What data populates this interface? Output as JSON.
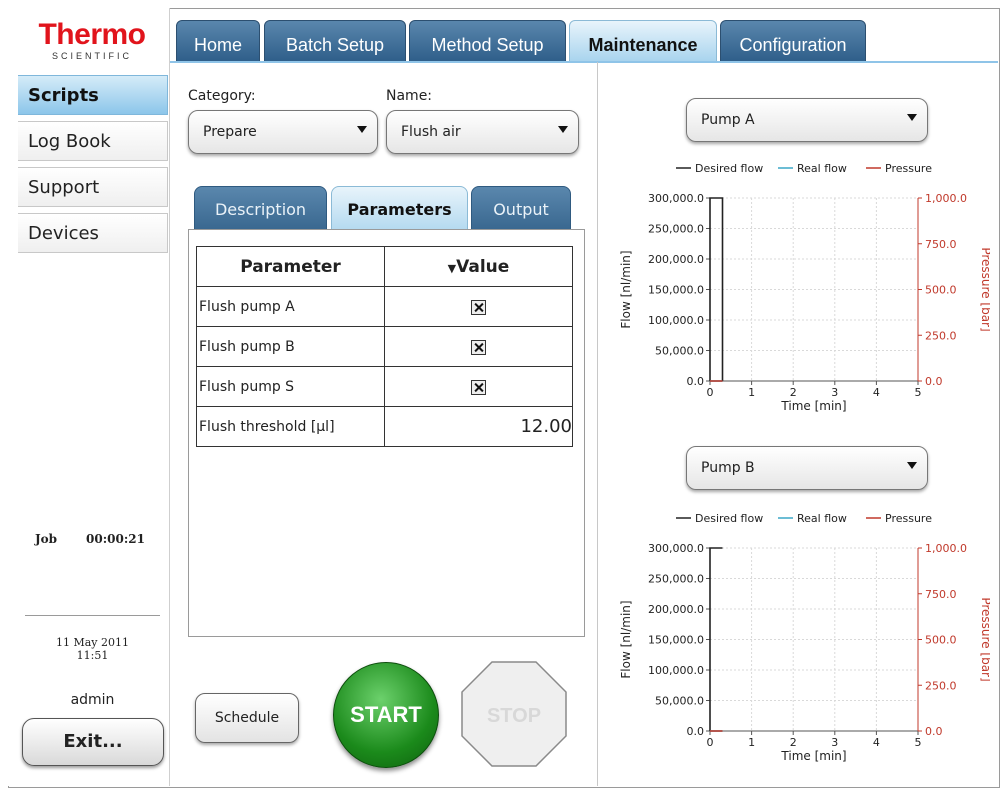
{
  "brand": {
    "name": "Thermo",
    "sub": "SCIENTIFIC"
  },
  "sidebar": {
    "items": [
      {
        "label": "Scripts",
        "active": true
      },
      {
        "label": "Log Book",
        "active": false
      },
      {
        "label": "Support",
        "active": false
      },
      {
        "label": "Devices",
        "active": false
      }
    ]
  },
  "status": {
    "job_label": "Job",
    "job_time": "00:00:21",
    "date": "11 May 2011",
    "time": "11:51",
    "user": "admin",
    "exit_label": "Exit..."
  },
  "tabs": [
    {
      "label": "Home",
      "active": false
    },
    {
      "label": "Batch Setup",
      "active": false
    },
    {
      "label": "Method Setup",
      "active": false
    },
    {
      "label": "Maintenance",
      "active": true
    },
    {
      "label": "Configuration",
      "active": false
    }
  ],
  "script": {
    "category_label": "Category:",
    "category_value": "Prepare",
    "name_label": "Name:",
    "name_value": "Flush air",
    "subtabs": [
      {
        "label": "Description",
        "active": false
      },
      {
        "label": "Parameters",
        "active": true
      },
      {
        "label": "Output",
        "active": false
      }
    ],
    "table": {
      "col_param": "Parameter",
      "col_value": "Value",
      "rows": [
        {
          "name": "Flush pump A",
          "type": "checkbox",
          "checked": true
        },
        {
          "name": "Flush pump B",
          "type": "checkbox",
          "checked": true
        },
        {
          "name": "Flush pump S",
          "type": "checkbox",
          "checked": true
        },
        {
          "name": "Flush threshold [µl]",
          "type": "number",
          "value": "12.00"
        }
      ]
    },
    "schedule_label": "Schedule",
    "start_label": "START",
    "stop_label": "STOP"
  },
  "colors": {
    "desired": "#222222",
    "real": "#3aa7c7",
    "pressure": "#c0392b",
    "accent": "#2f5f8a"
  },
  "chart_data": [
    {
      "type": "line",
      "selector": "Pump A",
      "legend": [
        "Desired flow",
        "Real flow",
        "Pressure"
      ],
      "xlabel": "Time [min]",
      "ylabel": "Flow [nl/min]",
      "y2label": "Pressure [bar]",
      "xlim": [
        0,
        5
      ],
      "ylim": [
        0,
        300000
      ],
      "y2lim": [
        0,
        1000
      ],
      "xticks": [
        "0",
        "1",
        "2",
        "3",
        "4",
        "5"
      ],
      "yticks": [
        "0.0",
        "50,000.0",
        "100,000.0",
        "150,000.0",
        "200,000.0",
        "250,000.0",
        "300,000.0"
      ],
      "y2ticks": [
        "0.0",
        "250.0",
        "500.0",
        "750.0",
        "1,000.0"
      ],
      "series": [
        {
          "name": "Desired flow",
          "x": [
            0,
            0,
            0.3,
            0.3
          ],
          "y": [
            0,
            300000,
            300000,
            0
          ]
        },
        {
          "name": "Real flow",
          "x": [
            0,
            0.3
          ],
          "y": [
            0,
            0
          ]
        },
        {
          "name": "Pressure",
          "x": [
            0,
            0.3
          ],
          "y2": [
            0,
            0
          ]
        }
      ]
    },
    {
      "type": "line",
      "selector": "Pump B",
      "legend": [
        "Desired flow",
        "Real flow",
        "Pressure"
      ],
      "xlabel": "Time [min]",
      "ylabel": "Flow [nl/min]",
      "y2label": "Pressure [bar]",
      "xlim": [
        0,
        5
      ],
      "ylim": [
        0,
        300000
      ],
      "y2lim": [
        0,
        1000
      ],
      "xticks": [
        "0",
        "1",
        "2",
        "3",
        "4",
        "5"
      ],
      "yticks": [
        "0.0",
        "50,000.0",
        "100,000.0",
        "150,000.0",
        "200,000.0",
        "250,000.0",
        "300,000.0"
      ],
      "y2ticks": [
        "0.0",
        "250.0",
        "500.0",
        "750.0",
        "1,000.0"
      ],
      "series": [
        {
          "name": "Desired flow",
          "x": [
            0,
            0,
            0.3
          ],
          "y": [
            0,
            300000,
            300000
          ]
        },
        {
          "name": "Real flow",
          "x": [
            0,
            0.3
          ],
          "y": [
            0,
            0
          ]
        },
        {
          "name": "Pressure",
          "x": [
            0,
            0.3
          ],
          "y2": [
            0,
            0
          ]
        }
      ]
    }
  ]
}
